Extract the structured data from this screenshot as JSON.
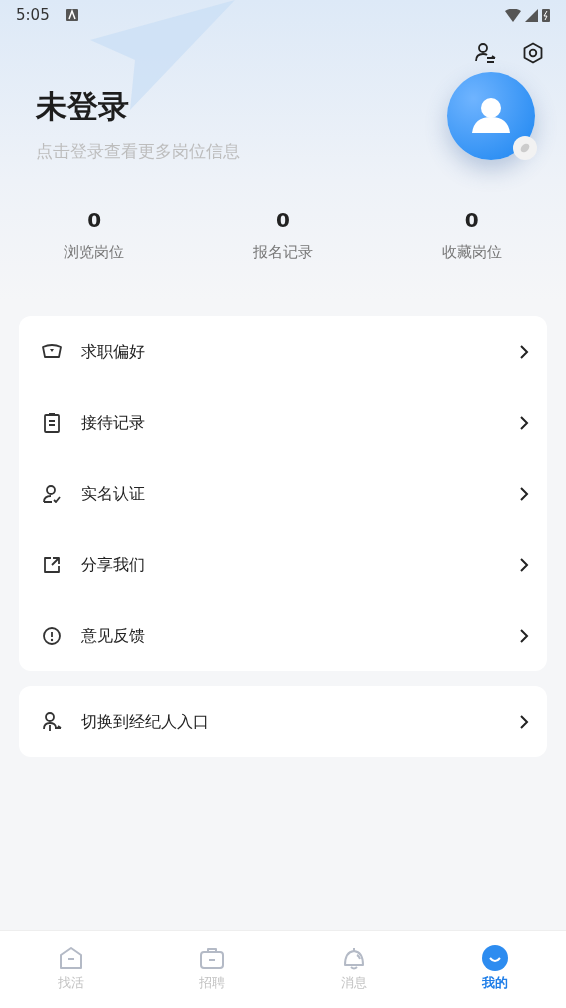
{
  "status_bar": {
    "time": "5:05"
  },
  "profile": {
    "title": "未登录",
    "subtitle": "点击登录查看更多岗位信息"
  },
  "stats": [
    {
      "value": "0",
      "label": "浏览岗位"
    },
    {
      "value": "0",
      "label": "报名记录"
    },
    {
      "value": "0",
      "label": "收藏岗位"
    }
  ],
  "menu": [
    {
      "label": "求职偏好"
    },
    {
      "label": "接待记录"
    },
    {
      "label": "实名认证"
    },
    {
      "label": "分享我们"
    },
    {
      "label": "意见反馈"
    }
  ],
  "switch_entry": {
    "label": "切换到经纪人入口"
  },
  "tabs": [
    {
      "label": "找活",
      "selected": false
    },
    {
      "label": "招聘",
      "selected": false
    },
    {
      "label": "消息",
      "selected": false
    },
    {
      "label": "我的",
      "selected": true
    }
  ]
}
